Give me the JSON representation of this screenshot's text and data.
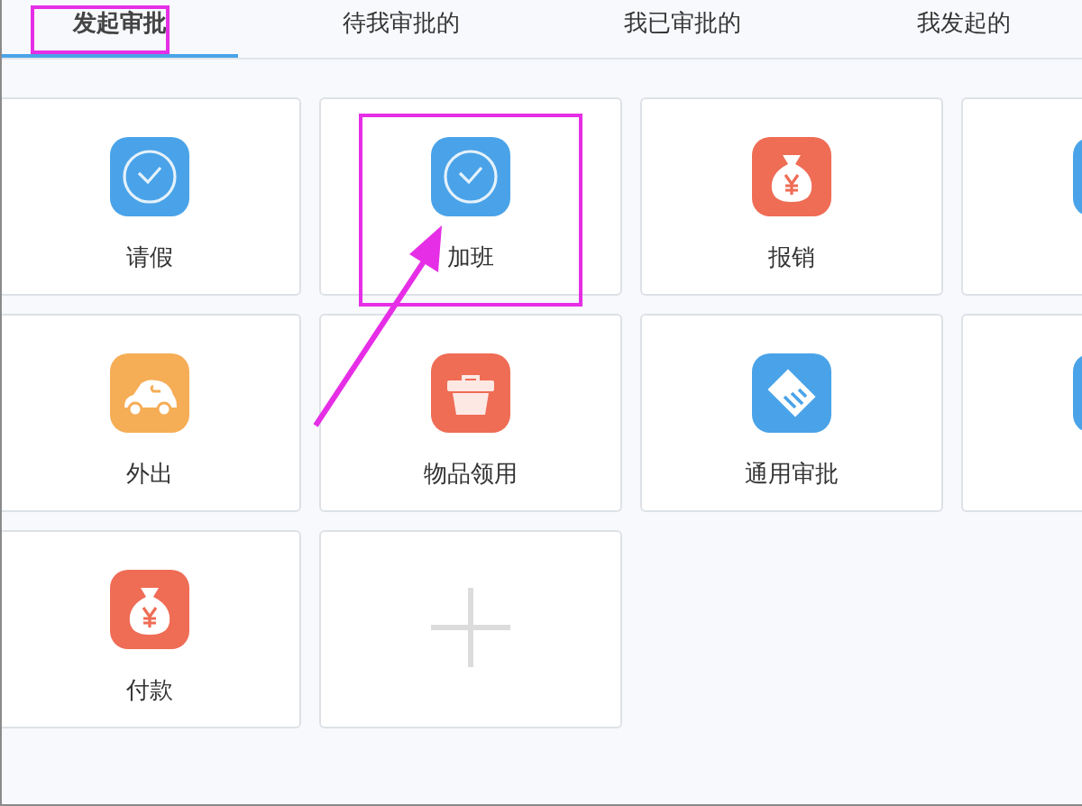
{
  "tabs": [
    {
      "label": "发起审批",
      "selected": true
    },
    {
      "label": "待我审批的",
      "selected": false
    },
    {
      "label": "我已审批的",
      "selected": false
    },
    {
      "label": "我发起的",
      "selected": false
    }
  ],
  "cards": [
    {
      "kind": "app",
      "label": "请假"
    },
    {
      "kind": "app",
      "label": "加班",
      "highlighted": true
    },
    {
      "kind": "app",
      "label": "报销"
    },
    {
      "kind": "app"
    },
    {
      "kind": "app",
      "label": "外出"
    },
    {
      "kind": "app",
      "label": "物品领用"
    },
    {
      "kind": "app",
      "label": "通用审批"
    },
    {
      "kind": "app"
    },
    {
      "kind": "app",
      "label": "付款"
    },
    {
      "kind": "add"
    }
  ]
}
